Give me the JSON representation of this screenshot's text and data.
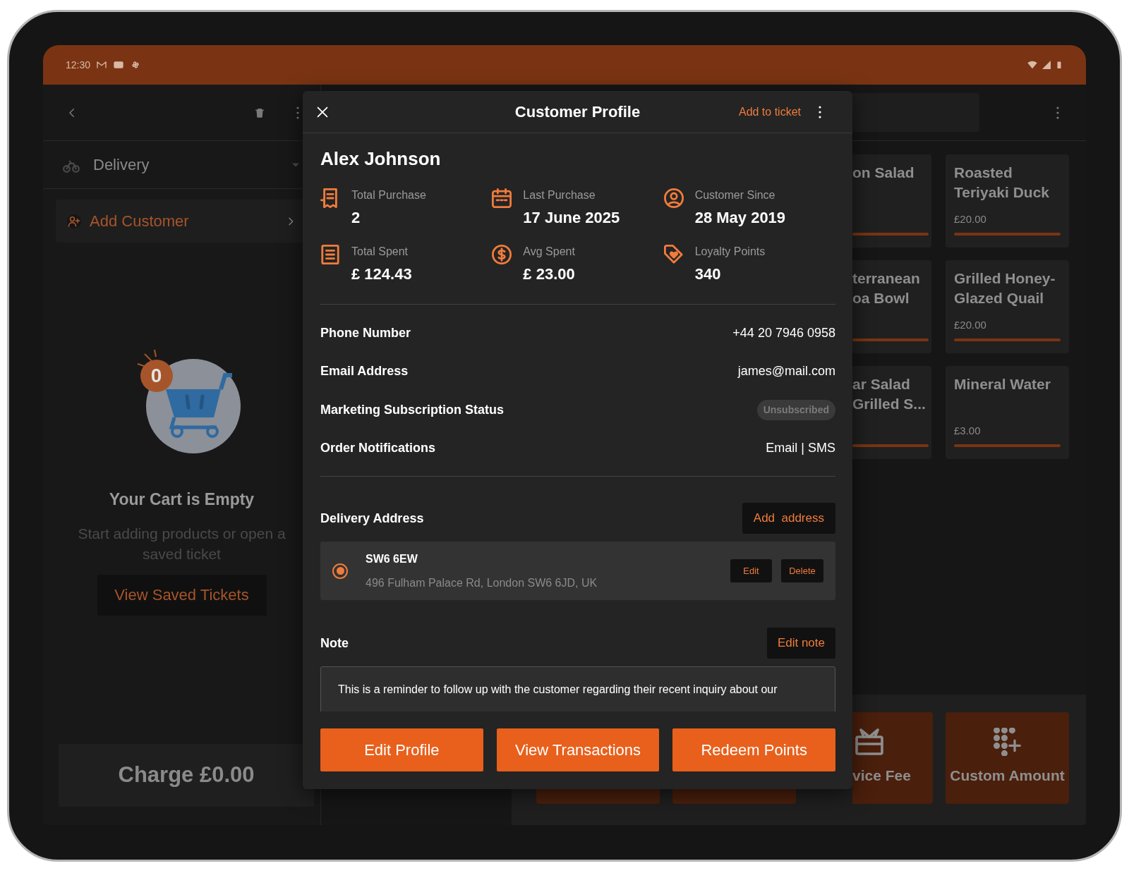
{
  "status_bar": {
    "time": "12:30"
  },
  "cart_panel": {
    "order_type": "Delivery",
    "add_customer": "Add Customer",
    "cart_count": "0",
    "empty_title": "Your Cart is Empty",
    "empty_text": "Start adding products or open a saved ticket",
    "saved_tickets_button": "View Saved Tickets",
    "charge_button": "Charge £0.00"
  },
  "products": [
    {
      "lines": [
        "on Salad"
      ]
    },
    {
      "lines": [
        "Roasted",
        "Teriyaki Duck"
      ],
      "price": "£20.00"
    },
    {
      "lines": [
        "terranean",
        "oa Bowl"
      ]
    },
    {
      "lines": [
        "Grilled Honey-",
        "Glazed Quail"
      ],
      "price": "£20.00"
    },
    {
      "lines": [
        "ar Salad",
        "Grilled S..."
      ]
    },
    {
      "lines": [
        "Mineral Water"
      ],
      "price": "£3.00"
    }
  ],
  "quick_tiles": [
    {
      "label": "vice Fee"
    },
    {
      "label": "Custom Amount"
    }
  ],
  "customer_profile": {
    "title": "Customer Profile",
    "add_to_ticket": "Add to ticket",
    "name": "Alex Johnson",
    "stats": [
      {
        "label": "Total Purchase",
        "value": "2"
      },
      {
        "label": "Last Purchase",
        "value": "17 June 2025"
      },
      {
        "label": "Customer Since",
        "value": "28 May 2019"
      },
      {
        "label": "Total Spent",
        "value": "£ 124.43"
      },
      {
        "label": "Avg Spent",
        "value": "£ 23.00"
      },
      {
        "label": "Loyalty Points",
        "value": "340"
      }
    ],
    "details": [
      {
        "kind": "text",
        "label": "Phone Number",
        "value": "+44 20 7946 0958"
      },
      {
        "kind": "text",
        "label": "Email Address",
        "value": "james@mail.com"
      },
      {
        "kind": "badge",
        "label": "Marketing Subscription Status",
        "value": "Unsubscribed"
      },
      {
        "kind": "text",
        "label": "Order Notifications",
        "value": "Email | SMS"
      }
    ],
    "delivery_address": {
      "label": "Delivery Address",
      "add_button": "Add  address",
      "addresses": [
        {
          "postcode": "SW6 6EW",
          "line": "496 Fulham Palace Rd, London SW6 6JD, UK",
          "selected": true,
          "edit": "Edit",
          "delete": "Delete"
        }
      ]
    },
    "note": {
      "label": "Note",
      "edit_button": "Edit note",
      "text": "This is a reminder to follow up with the customer regarding their recent inquiry about our"
    },
    "actions": [
      "Edit Profile",
      "View Transactions",
      "Redeem Points"
    ]
  }
}
